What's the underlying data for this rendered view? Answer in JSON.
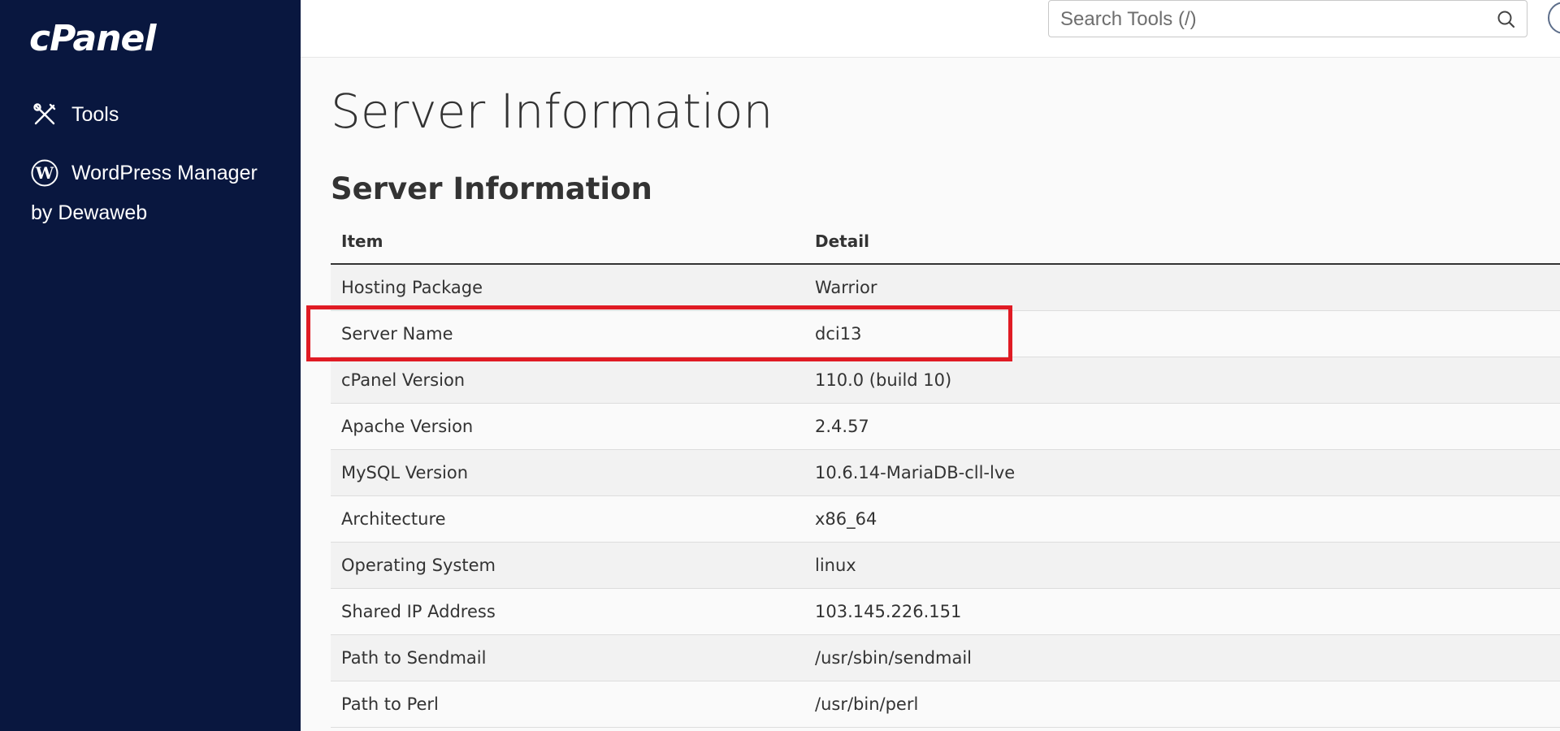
{
  "sidebar": {
    "logo": "cPanel",
    "items": [
      {
        "label": "Tools",
        "icon": "tools-icon"
      },
      {
        "label": "WordPress Manager",
        "label_line2": "by Dewaweb",
        "icon": "wordpress-icon"
      }
    ]
  },
  "header": {
    "search": {
      "placeholder": "Search Tools (/)"
    }
  },
  "main": {
    "page_title": "Server Information",
    "section_title": "Server Information",
    "table": {
      "columns": [
        "Item",
        "Detail"
      ],
      "rows": [
        {
          "item": "Hosting Package",
          "detail": "Warrior"
        },
        {
          "item": "Server Name",
          "detail": "dci13"
        },
        {
          "item": "cPanel Version",
          "detail": "110.0 (build 10)"
        },
        {
          "item": "Apache Version",
          "detail": "2.4.57"
        },
        {
          "item": "MySQL Version",
          "detail": "10.6.14-MariaDB-cll-lve"
        },
        {
          "item": "Architecture",
          "detail": "x86_64"
        },
        {
          "item": "Operating System",
          "detail": "linux"
        },
        {
          "item": "Shared IP Address",
          "detail": "103.145.226.151"
        },
        {
          "item": "Path to Sendmail",
          "detail": "/usr/sbin/sendmail"
        },
        {
          "item": "Path to Perl",
          "detail": "/usr/bin/perl"
        }
      ]
    }
  },
  "colors": {
    "sidebar_bg": "#09173f",
    "highlight": "#e01b24"
  }
}
